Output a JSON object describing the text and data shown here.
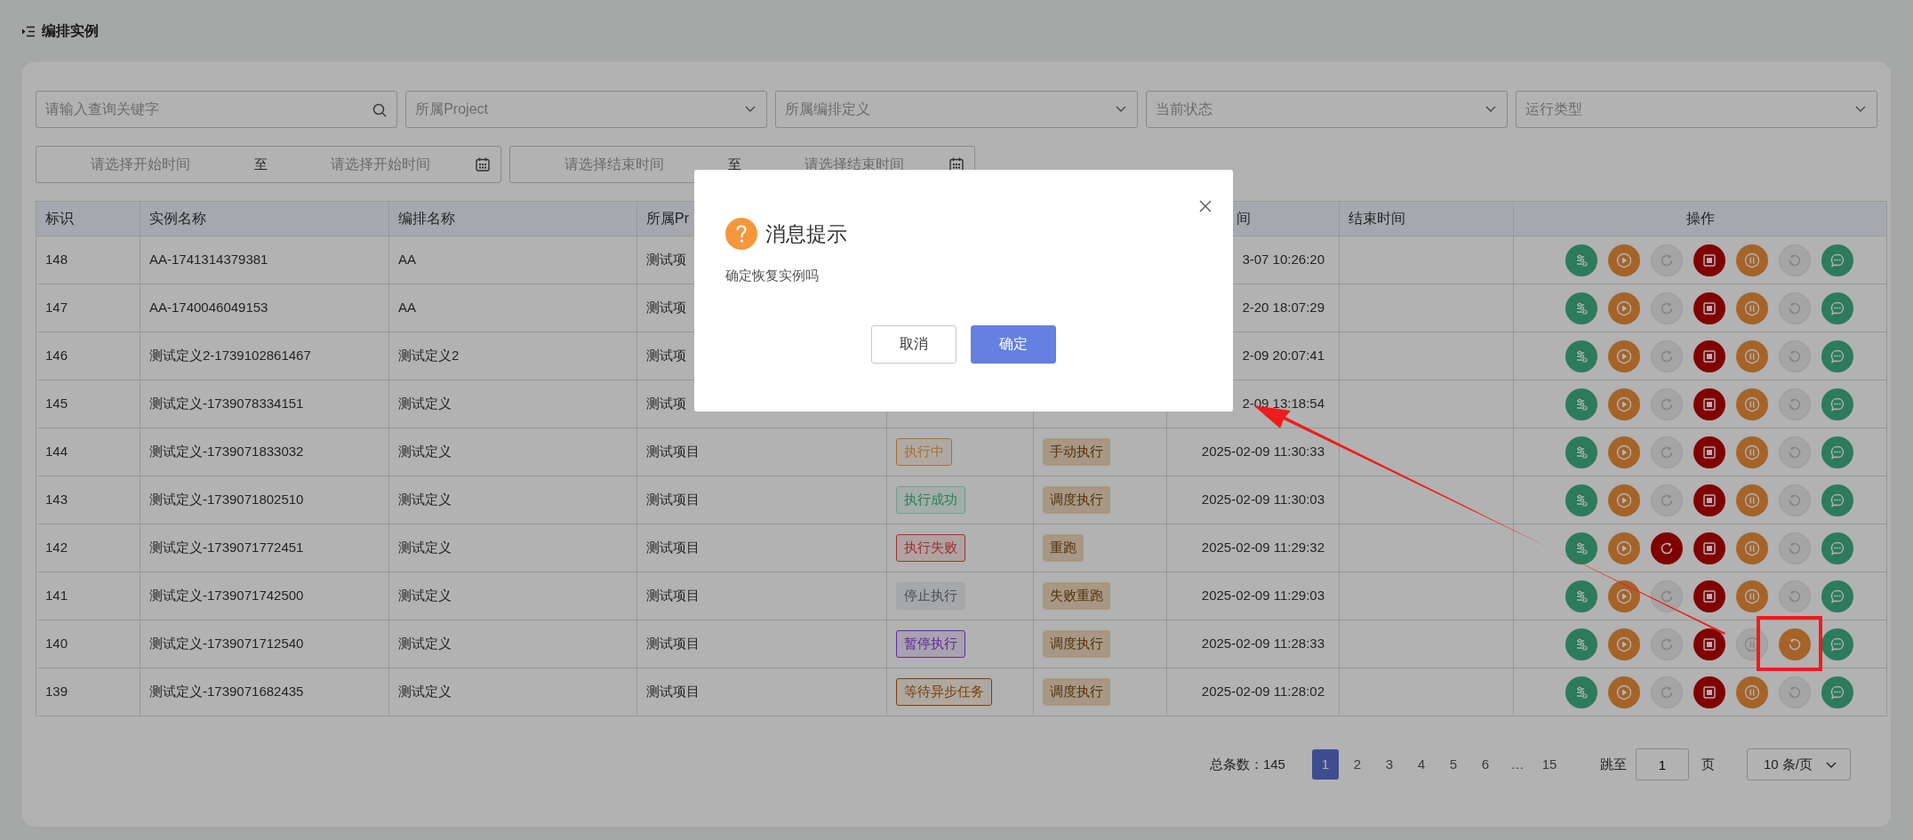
{
  "page": {
    "title": "编排实例"
  },
  "filters": [
    {
      "kind": "search",
      "placeholder": "请输入查询关键字"
    },
    {
      "kind": "select",
      "placeholder": "所属Project"
    },
    {
      "kind": "select",
      "placeholder": "所属编排定义"
    },
    {
      "kind": "select",
      "placeholder": "当前状态"
    },
    {
      "kind": "select",
      "placeholder": "运行类型"
    }
  ],
  "date_ranges": [
    {
      "start_placeholder": "请选择开始时间",
      "separator": "至",
      "end_placeholder": "请选择开始时间"
    },
    {
      "start_placeholder": "请选择结束时间",
      "separator": "至",
      "end_placeholder": "请选择结束时间"
    }
  ],
  "table": {
    "columns": [
      {
        "label": "标识"
      },
      {
        "label": "实例名称"
      },
      {
        "label": "编排名称"
      },
      {
        "label": "所属Pr"
      },
      {},
      {},
      {
        "label": "间"
      },
      {
        "label": "结束时间"
      },
      {
        "label": "操作"
      }
    ],
    "rows": [
      {
        "id": "148",
        "instance_name": "AA-1741314379381",
        "definition": "AA",
        "project": "测试项",
        "start_time": "3-07 10:26:20",
        "actions": [
          {
            "kind": "flow",
            "disabled": false
          },
          {
            "kind": "play",
            "disabled": false
          },
          {
            "kind": "rerun",
            "disabled": true
          },
          {
            "kind": "stop",
            "disabled": false
          },
          {
            "kind": "pause",
            "disabled": false
          },
          {
            "kind": "resume",
            "disabled": true
          },
          {
            "kind": "message",
            "disabled": false
          }
        ]
      },
      {
        "id": "147",
        "instance_name": "AA-1740046049153",
        "definition": "AA",
        "project": "测试项",
        "start_time": "2-20 18:07:29",
        "actions": [
          {
            "kind": "flow",
            "disabled": false
          },
          {
            "kind": "play",
            "disabled": false
          },
          {
            "kind": "rerun",
            "disabled": true
          },
          {
            "kind": "stop",
            "disabled": false
          },
          {
            "kind": "pause",
            "disabled": false
          },
          {
            "kind": "resume",
            "disabled": true
          },
          {
            "kind": "message",
            "disabled": false
          }
        ]
      },
      {
        "id": "146",
        "instance_name": "测试定义2-1739102861467",
        "definition": "测试定义2",
        "project": "测试项",
        "start_time": "2-09 20:07:41",
        "actions": [
          {
            "kind": "flow",
            "disabled": false
          },
          {
            "kind": "play",
            "disabled": false
          },
          {
            "kind": "rerun",
            "disabled": true
          },
          {
            "kind": "stop",
            "disabled": false
          },
          {
            "kind": "pause",
            "disabled": false
          },
          {
            "kind": "resume",
            "disabled": true
          },
          {
            "kind": "message",
            "disabled": false
          }
        ]
      },
      {
        "id": "145",
        "instance_name": "测试定义-1739078334151",
        "definition": "测试定义",
        "project": "测试项",
        "start_time": "2-09 13:18:54",
        "actions": [
          {
            "kind": "flow",
            "disabled": false
          },
          {
            "kind": "play",
            "disabled": false
          },
          {
            "kind": "rerun",
            "disabled": true
          },
          {
            "kind": "stop",
            "disabled": false
          },
          {
            "kind": "pause",
            "disabled": false
          },
          {
            "kind": "resume",
            "disabled": true
          },
          {
            "kind": "message",
            "disabled": false
          }
        ]
      },
      {
        "id": "144",
        "instance_name": "测试定义-1739071833032",
        "definition": "测试定义",
        "project": "测试项目",
        "status": {
          "label": "执行中",
          "kind": "running"
        },
        "run_type": "手动执行",
        "start_time": "2025-02-09 11:30:33",
        "actions": [
          {
            "kind": "flow",
            "disabled": false
          },
          {
            "kind": "play",
            "disabled": false
          },
          {
            "kind": "rerun",
            "disabled": true
          },
          {
            "kind": "stop",
            "disabled": false
          },
          {
            "kind": "pause",
            "disabled": false
          },
          {
            "kind": "resume",
            "disabled": true
          },
          {
            "kind": "message",
            "disabled": false
          }
        ]
      },
      {
        "id": "143",
        "instance_name": "测试定义-1739071802510",
        "definition": "测试定义",
        "project": "测试项目",
        "status": {
          "label": "执行成功",
          "kind": "success"
        },
        "run_type": "调度执行",
        "start_time": "2025-02-09 11:30:03",
        "actions": [
          {
            "kind": "flow",
            "disabled": false
          },
          {
            "kind": "play",
            "disabled": false
          },
          {
            "kind": "rerun",
            "disabled": true
          },
          {
            "kind": "stop",
            "disabled": false
          },
          {
            "kind": "pause",
            "disabled": false
          },
          {
            "kind": "resume",
            "disabled": true
          },
          {
            "kind": "message",
            "disabled": false
          }
        ]
      },
      {
        "id": "142",
        "instance_name": "测试定义-1739071772451",
        "definition": "测试定义",
        "project": "测试项目",
        "status": {
          "label": "执行失败",
          "kind": "failed"
        },
        "run_type": "重跑",
        "start_time": "2025-02-09 11:29:32",
        "actions": [
          {
            "kind": "flow",
            "disabled": false
          },
          {
            "kind": "play",
            "disabled": false
          },
          {
            "kind": "rerun",
            "disabled": false
          },
          {
            "kind": "stop",
            "disabled": false
          },
          {
            "kind": "pause",
            "disabled": false
          },
          {
            "kind": "resume",
            "disabled": true
          },
          {
            "kind": "message",
            "disabled": false
          }
        ]
      },
      {
        "id": "141",
        "instance_name": "测试定义-1739071742500",
        "definition": "测试定义",
        "project": "测试项目",
        "status": {
          "label": "停止执行",
          "kind": "stopped"
        },
        "run_type": "失败重跑",
        "start_time": "2025-02-09 11:29:03",
        "actions": [
          {
            "kind": "flow",
            "disabled": false
          },
          {
            "kind": "play",
            "disabled": false
          },
          {
            "kind": "rerun",
            "disabled": true
          },
          {
            "kind": "stop",
            "disabled": false
          },
          {
            "kind": "pause",
            "disabled": false
          },
          {
            "kind": "resume",
            "disabled": true
          },
          {
            "kind": "message",
            "disabled": false
          }
        ]
      },
      {
        "id": "140",
        "instance_name": "测试定义-1739071712540",
        "definition": "测试定义",
        "project": "测试项目",
        "status": {
          "label": "暂停执行",
          "kind": "paused"
        },
        "run_type": "调度执行",
        "start_time": "2025-02-09 11:28:33",
        "actions": [
          {
            "kind": "flow",
            "disabled": false
          },
          {
            "kind": "play",
            "disabled": false
          },
          {
            "kind": "rerun",
            "disabled": true
          },
          {
            "kind": "stop",
            "disabled": false
          },
          {
            "kind": "pause",
            "disabled": true
          },
          {
            "kind": "resume",
            "disabled": false
          },
          {
            "kind": "message",
            "disabled": false
          }
        ]
      },
      {
        "id": "139",
        "instance_name": "测试定义-1739071682435",
        "definition": "测试定义",
        "project": "测试项目",
        "status": {
          "label": "等待异步任务",
          "kind": "waiting"
        },
        "run_type": "调度执行",
        "start_time": "2025-02-09 11:28:02",
        "actions": [
          {
            "kind": "flow",
            "disabled": false
          },
          {
            "kind": "play",
            "disabled": false
          },
          {
            "kind": "rerun",
            "disabled": true
          },
          {
            "kind": "stop",
            "disabled": false
          },
          {
            "kind": "pause",
            "disabled": false
          },
          {
            "kind": "resume",
            "disabled": true
          },
          {
            "kind": "message",
            "disabled": false
          }
        ]
      }
    ]
  },
  "pagination": {
    "total_label": "总条数：145",
    "pages": [
      {
        "label": "1",
        "selected": true
      },
      {
        "label": "2",
        "selected": false
      },
      {
        "label": "3",
        "selected": false
      },
      {
        "label": "4",
        "selected": false
      },
      {
        "label": "5",
        "selected": false
      },
      {
        "label": "6",
        "selected": false
      },
      {
        "label": "…",
        "selected": false
      },
      {
        "label": "15",
        "selected": false
      }
    ],
    "jump_label": "跳至",
    "jump_value": "1",
    "page_unit": "页",
    "page_size": "10 条/页"
  },
  "dialog": {
    "title": "消息提示",
    "message": "确定恢复实例吗",
    "buttons": [
      {
        "label": "取消",
        "kind": "secondary"
      },
      {
        "label": "确定",
        "kind": "primary"
      }
    ]
  }
}
